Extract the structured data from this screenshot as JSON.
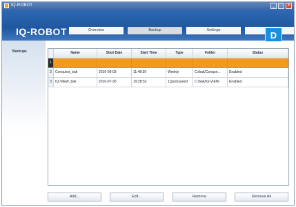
{
  "window": {
    "title": "IQ-ROBOT"
  },
  "header": {
    "brand": "IQ-ROBOT",
    "tabs": [
      {
        "label": "Overview"
      },
      {
        "label": "Backup"
      },
      {
        "label": "Settings"
      },
      {
        "label": ""
      }
    ],
    "overlay_letter": "D"
  },
  "sidebar": {
    "label": "Backups"
  },
  "table": {
    "columns": [
      "Name",
      "Start Date",
      "Start Time",
      "Type",
      "Folder",
      "Status"
    ],
    "rows": [
      {
        "idx": "1",
        "name": "",
        "start_date": "",
        "start_time": "",
        "type": "",
        "folder": "",
        "status": "",
        "selected": true
      },
      {
        "idx": "2",
        "name": "Conquest_bak",
        "start_date": "2010-08-03",
        "start_time": "11:48:39",
        "type": "Weekly",
        "folder": "C:/bak/Conque...",
        "status": "Enabled",
        "selected": false
      },
      {
        "idx": "3",
        "name": "IQ-VIEW_bak",
        "start_date": "2010-07-30",
        "start_time": "19:28:53",
        "type": "1Quicksaved",
        "folder": "C:/bak/IQ-VIEW",
        "status": "Enabled",
        "selected": false
      }
    ]
  },
  "buttons": {
    "add": "Add...",
    "edit": "Edit...",
    "remove": "Remove",
    "remove_all": "Remove All"
  },
  "colors": {
    "header_blue": "#2f68b3",
    "selection_orange": "#f39a1e",
    "badge_blue": "#1a8fdc"
  }
}
